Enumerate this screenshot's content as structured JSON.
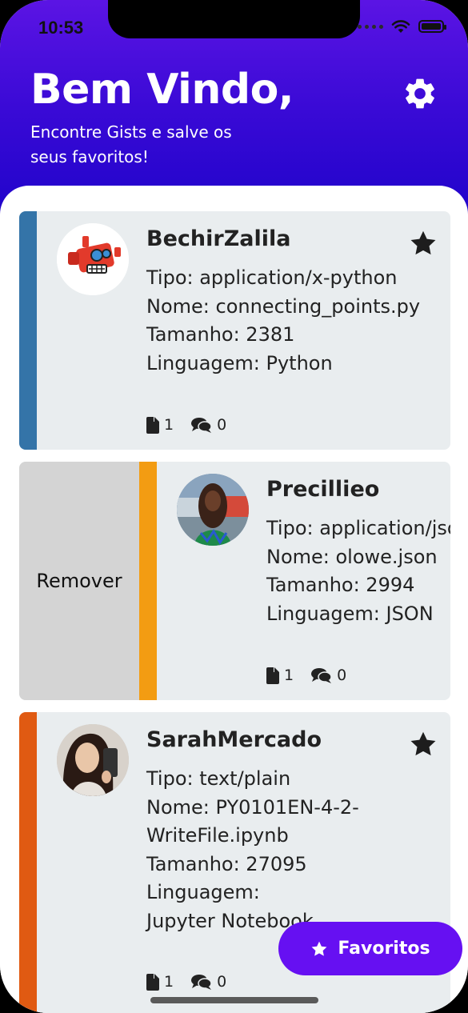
{
  "status_bar": {
    "time": "10:53"
  },
  "header": {
    "title": "Bem Vindo,",
    "subtitle": "Encontre Gists e salve os seus favoritos!"
  },
  "colors": {
    "header_top": "#5b14e4",
    "header_bottom": "#1a02c8",
    "card_bg": "#e9edef",
    "accent_blue": "#3474a8",
    "accent_orange": "#f39c12",
    "accent_deep_orange": "#e05a12",
    "fab_bg": "#6610f2"
  },
  "gists": [
    {
      "user": "BechirZalila",
      "lines": [
        "Tipo: application/x-python",
        "Nome: connecting_points.py",
        "Tamanho: 2381",
        "Linguagem: Python"
      ],
      "files": "1",
      "comments": "0",
      "favorited": true,
      "stripe_color": "#3474a8"
    },
    {
      "user": "Precillieo",
      "lines": [
        "Tipo: application/json",
        "Nome: olowe.json",
        "Tamanho: 2994",
        "Linguagem: JSON"
      ],
      "files": "1",
      "comments": "0",
      "favorited": true,
      "stripe_color": "#f39c12",
      "swipe_action": "Remover"
    },
    {
      "user": "SarahMercado",
      "lines": [
        "Tipo: text/plain",
        "Nome: PY0101EN-4-2-",
        "WriteFile.ipynb",
        "Tamanho: 27095",
        "Linguagem:",
        "Jupyter Notebook"
      ],
      "files": "1",
      "comments": "0",
      "favorited": true,
      "stripe_color": "#e05a12"
    }
  ],
  "fab": {
    "label": "Favoritos",
    "icon": "star-icon"
  },
  "icons": {
    "settings": "gear-icon",
    "file": "file-icon",
    "comments": "comments-icon",
    "favorite": "star-icon"
  }
}
